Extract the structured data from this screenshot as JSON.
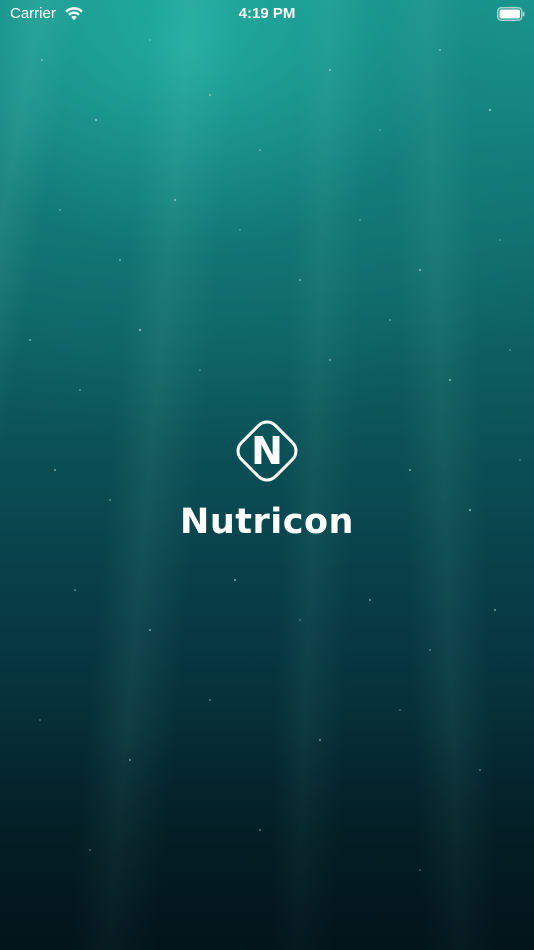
{
  "status_bar": {
    "carrier": "Carrier",
    "time": "4:19 PM",
    "wifi_icon": "wifi-icon",
    "battery_icon": "battery-full-icon"
  },
  "splash": {
    "logo_letter": "N",
    "brand_name": "Nutricon",
    "logo_icon": "nutricon-logo-icon"
  },
  "colors": {
    "background_top": "#1a9a90",
    "background_bottom": "#031a21",
    "text": "#ffffff"
  }
}
